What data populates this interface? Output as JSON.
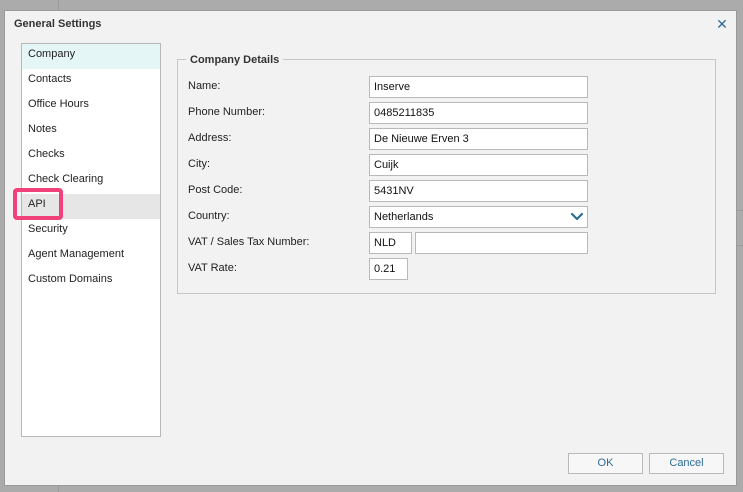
{
  "window": {
    "title": "General Settings"
  },
  "sidebar": {
    "items": [
      {
        "label": "Company",
        "state": "selected"
      },
      {
        "label": "Contacts"
      },
      {
        "label": "Office Hours"
      },
      {
        "label": "Notes"
      },
      {
        "label": "Checks"
      },
      {
        "label": "Check Clearing"
      },
      {
        "label": "API",
        "state": "hover"
      },
      {
        "label": "Security"
      },
      {
        "label": "Agent Management"
      },
      {
        "label": "Custom Domains"
      }
    ]
  },
  "company_details": {
    "legend": "Company Details",
    "name": {
      "label": "Name:",
      "value": "Inserve"
    },
    "phone": {
      "label": "Phone Number:",
      "value": "0485211835"
    },
    "address": {
      "label": "Address:",
      "value": "De Nieuwe Erven 3"
    },
    "city": {
      "label": "City:",
      "value": "Cuijk"
    },
    "post_code": {
      "label": "Post Code:",
      "value": "5431NV"
    },
    "country": {
      "label": "Country:",
      "value": "Netherlands"
    },
    "vat_number": {
      "label": "VAT / Sales Tax Number:",
      "prefix": "NLD",
      "value": ""
    },
    "vat_rate": {
      "label": "VAT Rate:",
      "value": "0.21"
    }
  },
  "footer": {
    "ok_label": "OK",
    "cancel_label": "Cancel"
  },
  "colors": {
    "accent": "#2d6d96",
    "highlight": "#f0417a",
    "selected_bg": "#e5f6f6"
  }
}
